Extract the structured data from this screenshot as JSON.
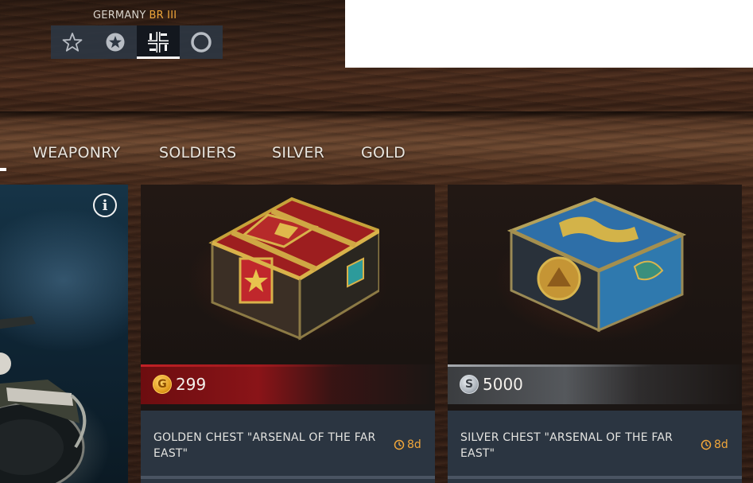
{
  "nation": {
    "name": "GERMANY",
    "battle_rating": "BR III"
  },
  "rank_tabs": [
    {
      "name": "star-outline",
      "active": false
    },
    {
      "name": "star-filled",
      "active": false
    },
    {
      "name": "balkenkreuz",
      "active": true
    },
    {
      "name": "circle",
      "active": false
    }
  ],
  "main_tabs": [
    "WEAPONRY",
    "SOLDIERS",
    "SILVER",
    "GOLD"
  ],
  "featured": {
    "info_icon": "info-icon"
  },
  "cards": [
    {
      "currency": "gold",
      "coin_letter": "G",
      "price": "299",
      "name": "GOLDEN CHEST \"ARSENAL OF THE FAR EAST\"",
      "timer": "8d"
    },
    {
      "currency": "silver",
      "coin_letter": "S",
      "price": "5000",
      "name": "SILVER CHEST \"ARSENAL OF THE FAR EAST\"",
      "timer": "8d"
    }
  ],
  "colors": {
    "accent": "#f0a63a",
    "gold_strip": "#8a1418",
    "silver_strip": "#55585c",
    "card_name_bg": "#2b3541"
  }
}
